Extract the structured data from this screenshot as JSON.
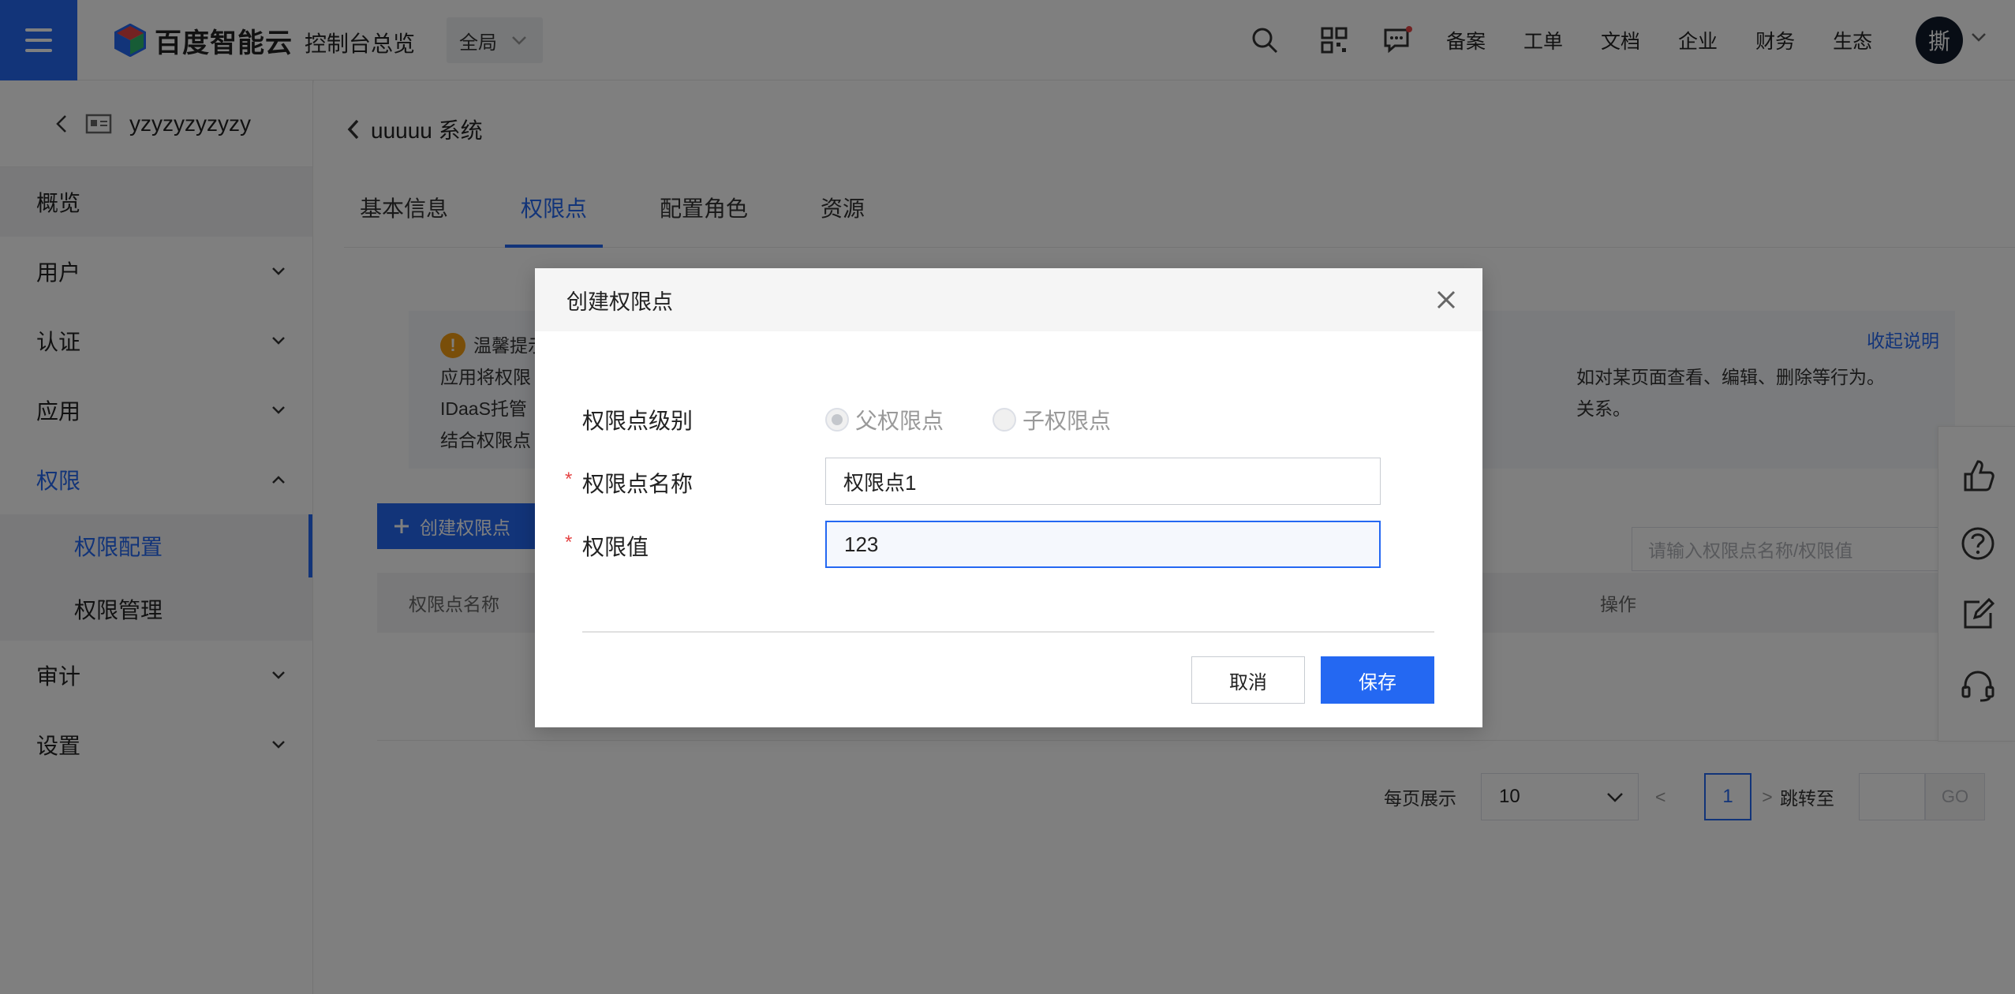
{
  "header": {
    "brand": "百度智能云",
    "console_title": "控制台总览",
    "region": "全局",
    "links": [
      "备案",
      "工单",
      "文档",
      "企业",
      "财务",
      "生态"
    ],
    "avatar_text": "撕"
  },
  "sidebar": {
    "instance_name": "yzyzyzyzyzy",
    "items": [
      {
        "label": "概览"
      },
      {
        "label": "用户"
      },
      {
        "label": "认证"
      },
      {
        "label": "应用"
      },
      {
        "label": "权限"
      },
      {
        "label": "审计"
      },
      {
        "label": "设置"
      }
    ],
    "sub_items": [
      {
        "label": "权限配置"
      },
      {
        "label": "权限管理"
      }
    ]
  },
  "main": {
    "breadcrumb": "uuuuu 系统",
    "tabs": [
      "基本信息",
      "权限点",
      "配置角色",
      "资源"
    ],
    "notice": {
      "title": "温馨提示",
      "line1": "应用将权限",
      "line1_tail": "如对某页面查看、编辑、删除等行为。",
      "line2": "IDaaS托管",
      "line2_tail": "关系。",
      "line3": "结合权限点",
      "collapse": "收起说明"
    },
    "create_button": "创建权限点",
    "search_placeholder": "请输入权限点名称/权限值",
    "table_headers": {
      "name": "权限点名称",
      "ops": "操作"
    },
    "pager": {
      "per_page_label": "每页展示",
      "per_page_value": "10",
      "prev": "<",
      "page": "1",
      "next": ">",
      "jump_label": "跳转至",
      "go": "GO"
    }
  },
  "modal": {
    "title": "创建权限点",
    "level_label": "权限点级别",
    "level_options": [
      "父权限点",
      "子权限点"
    ],
    "name_label": "权限点名称",
    "name_value": "权限点1",
    "value_label": "权限值",
    "value_value": "123",
    "required_mark": "*",
    "cancel": "取消",
    "save": "保存"
  },
  "colors": {
    "primary": "#2468f2",
    "required": "#e54545",
    "warning": "#f39c12"
  }
}
